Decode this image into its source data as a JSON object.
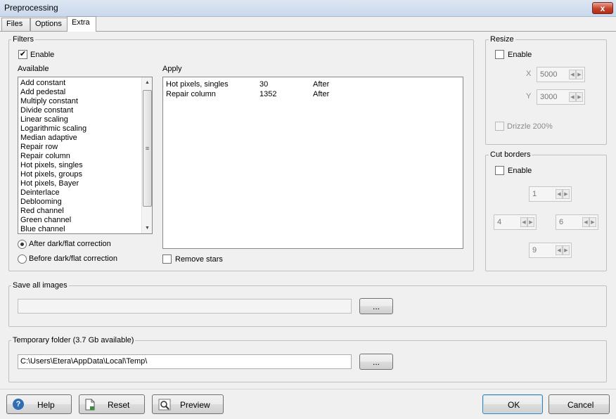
{
  "window": {
    "title": "Preprocessing",
    "close_glyph": "x"
  },
  "tabs": [
    {
      "label": "Files",
      "active": false
    },
    {
      "label": "Options",
      "active": false
    },
    {
      "label": "Extra",
      "active": true
    }
  ],
  "filters": {
    "legend": "Filters",
    "enable_label": "Enable",
    "enable_checked": true,
    "available_label": "Available",
    "available_items": [
      "Add constant",
      "Add pedestal",
      "Multiply constant",
      "Divide constant",
      "Linear scaling",
      "Logarithmic scaling",
      "Median adaptive",
      "Repair row",
      "Repair column",
      "Hot pixels, singles",
      "Hot pixels, groups",
      "Hot pixels, Bayer",
      "Deinterlace",
      "Deblooming",
      "Red channel",
      "Green channel",
      "Blue channel"
    ],
    "apply_label": "Apply",
    "apply_rows": [
      {
        "name": "Hot pixels, singles",
        "value": "30",
        "when": "After"
      },
      {
        "name": "Repair column",
        "value": "1352",
        "when": "After"
      }
    ],
    "radio_after": "After dark/flat correction",
    "radio_before": "Before dark/flat correction",
    "radio_selected": "after",
    "remove_stars_label": "Remove stars",
    "remove_stars_checked": false
  },
  "resize": {
    "legend": "Resize",
    "enable_label": "Enable",
    "x_label": "X",
    "x_value": "5000",
    "y_label": "Y",
    "y_value": "3000",
    "drizzle_label": "Drizzle 200%"
  },
  "cut_borders": {
    "legend": "Cut borders",
    "enable_label": "Enable",
    "top_value": "1",
    "left_value": "4",
    "right_value": "6",
    "bottom_value": "9"
  },
  "save_all": {
    "legend": "Save all images",
    "path": "",
    "browse_label": "..."
  },
  "temp_folder": {
    "legend": "Temporary folder (3.7 Gb available)",
    "path": "C:\\Users\\Etera\\AppData\\Local\\Temp\\",
    "browse_label": "..."
  },
  "buttons": {
    "help": "Help",
    "reset": "Reset",
    "preview": "Preview",
    "ok": "OK",
    "cancel": "Cancel"
  },
  "glyphs": {
    "check": "✔",
    "arrow_up": "▲",
    "arrow_down": "▼",
    "arrow_left": "◀",
    "arrow_right": "▶",
    "grip": "≡",
    "help_icon": "?"
  },
  "colors": {
    "help_icon_bg": "#2f6db5"
  }
}
